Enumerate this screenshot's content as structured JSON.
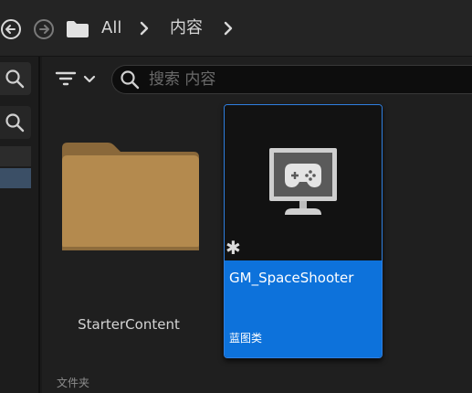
{
  "breadcrumb": {
    "root_label": "All",
    "current_label": "内容"
  },
  "search": {
    "placeholder": "搜索 内容"
  },
  "folders": [
    {
      "name": "StarterContent",
      "type_label": "文件夹"
    }
  ],
  "assets": [
    {
      "name": "GM_SpaceShooter",
      "type_label": "蓝图类",
      "selected": true
    }
  ],
  "colors": {
    "accent": "#0d72db",
    "folder": "#b48a4e",
    "background": "#1f1f1f"
  },
  "icons": {
    "back": "circle-arrow-left-icon",
    "forward": "circle-arrow-right-icon",
    "folder": "folder-icon",
    "filter": "filter-icon",
    "search": "search-icon",
    "asset_thumbnail": "game-controller-monitor-icon",
    "modified": "asterisk-icon"
  }
}
